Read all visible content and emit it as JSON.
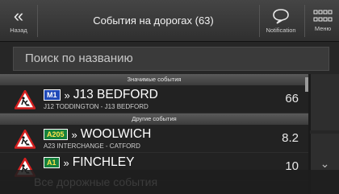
{
  "topbar": {
    "back_label": "Назад",
    "title": "События на дорогах (63)",
    "notification_label": "Notification",
    "menu_label": "Меню"
  },
  "search": {
    "placeholder": "Поиск по названию"
  },
  "sections": [
    {
      "header": "Значимые события",
      "items": [
        {
          "badge": "M1",
          "badge_type": "motorway",
          "name": "J13 BEDFORD",
          "sub": "J12 TODDINGTON - J13 BEDFORD",
          "distance": "66"
        }
      ]
    },
    {
      "header": "Другие события",
      "items": [
        {
          "badge": "A205",
          "badge_type": "primary",
          "name": "WOOLWICH",
          "sub": "A23 INTERCHANGE - CATFORD",
          "distance": "8.2"
        },
        {
          "badge": "A1",
          "badge_type": "primary",
          "name": "FINCHLEY",
          "sub": "",
          "distance": "10"
        }
      ]
    }
  ],
  "overlay_text": "Все дорожные события",
  "colors": {
    "motorway_badge": "#1f49b8",
    "primary_badge": "#15803d",
    "warning_red": "#d62020"
  }
}
